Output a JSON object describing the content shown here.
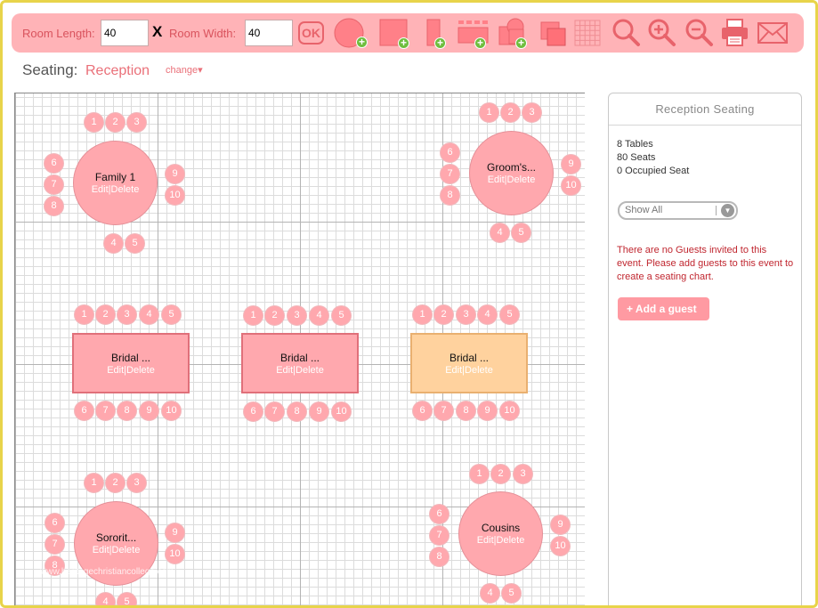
{
  "toolbar": {
    "room_length_label": "Room Length:",
    "room_length_value": "40",
    "x_label": "X",
    "room_width_label": "Room Width:",
    "room_width_value": "40",
    "ok_label": "OK",
    "tools": [
      "add-round-table",
      "add-square-table",
      "add-rect-table",
      "add-banquet-table",
      "add-mixed-tables",
      "duplicate",
      "grid-toggle",
      "zoom",
      "zoom-in",
      "zoom-out",
      "print",
      "email"
    ]
  },
  "seating": {
    "label": "Seating:",
    "event_name": "Reception",
    "change_label": "change"
  },
  "tables": [
    {
      "id": "family1",
      "name": "Family 1",
      "edit": "Edit",
      "sep": "|",
      "delete": "Delete",
      "seats": [
        "1",
        "2",
        "3",
        "4",
        "5",
        "6",
        "7",
        "8",
        "9",
        "10"
      ]
    },
    {
      "id": "grooms",
      "name": "Groom's...",
      "edit": "Edit",
      "sep": "|",
      "delete": "Delete",
      "seats": [
        "1",
        "2",
        "3",
        "4",
        "5",
        "6",
        "7",
        "8",
        "9",
        "10"
      ]
    },
    {
      "id": "bridal1",
      "name": "Bridal ...",
      "edit": "Edit",
      "sep": "|",
      "delete": "Delete",
      "seats": [
        "1",
        "2",
        "3",
        "4",
        "5",
        "6",
        "7",
        "8",
        "9",
        "10"
      ]
    },
    {
      "id": "bridal2",
      "name": "Bridal ...",
      "edit": "Edit",
      "sep": "|",
      "delete": "Delete",
      "seats": [
        "1",
        "2",
        "3",
        "4",
        "5",
        "6",
        "7",
        "8",
        "9",
        "10"
      ]
    },
    {
      "id": "bridal3",
      "name": "Bridal ...",
      "edit": "Edit",
      "sep": "|",
      "delete": "Delete",
      "seats": [
        "1",
        "2",
        "3",
        "4",
        "5",
        "6",
        "7",
        "8",
        "9",
        "10"
      ]
    },
    {
      "id": "sorority",
      "name": "Sororit...",
      "edit": "Edit",
      "sep": "|",
      "delete": "Delete",
      "seats": [
        "1",
        "2",
        "3",
        "4",
        "5",
        "6",
        "7",
        "8",
        "9",
        "10"
      ]
    },
    {
      "id": "cousins",
      "name": "Cousins",
      "edit": "Edit",
      "sep": "|",
      "delete": "Delete",
      "seats": [
        "1",
        "2",
        "3",
        "4",
        "5",
        "6",
        "7",
        "8",
        "9",
        "10"
      ]
    }
  ],
  "watermark": "www.heritagechristiancollege.com",
  "panel": {
    "title": "Reception Seating",
    "tables_count": "8 Tables",
    "seats_count": "80 Seats",
    "occupied_count": "0 Occupied Seat",
    "filter_value": "Show All",
    "no_guests_message": "There are no Guests invited to this event. Please add guests to this event to create a seating chart.",
    "add_guest_label": "Add a guest"
  },
  "colors": {
    "accent": "#ffb3b7",
    "table": "#ffa8ae",
    "selected_table": "#ffd29e",
    "frame": "#e8d44a",
    "error_text": "#c0262f"
  }
}
